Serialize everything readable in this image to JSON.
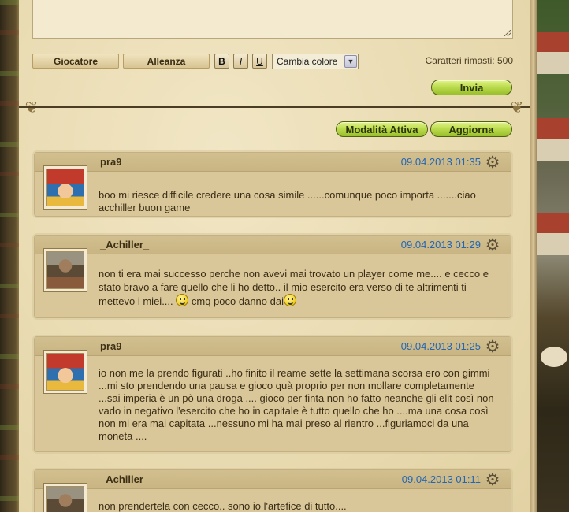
{
  "toolbar": {
    "player_label": "Giocatore",
    "alliance_label": "Alleanza",
    "bold_label": "B",
    "italic_label": "I",
    "underline_label": "U",
    "color_select_value": "Cambia colore",
    "chars_remaining": "Caratteri rimasti: 500"
  },
  "actions": {
    "send_label": "Invia",
    "active_mode_label": "Modalità Attiva",
    "refresh_label": "Aggiorna"
  },
  "posts": [
    {
      "author": "pra9",
      "date": "09.04.2013 01:35",
      "avatar": "jester",
      "text": "boo mi riesce difficile credere una cosa simile ......comunque poco importa .......ciao acchiller buon game"
    },
    {
      "author": "_Achiller_",
      "date": "09.04.2013 01:29",
      "avatar": "warrior",
      "text_part1": "non ti era mai successo perche non avevi mai trovato un player come me.... e cecco e stato bravo a fare quello che li ho detto.. il mio esercito era verso di te altrimenti ti mettevo i miei....",
      "text_part2": "cmq poco danno dai"
    },
    {
      "author": "pra9",
      "date": "09.04.2013 01:25",
      "avatar": "jester",
      "text": "io non me la prendo figurati ..ho finito il reame sette la settimana scorsa ero con gimmi ...mi sto prendendo una pausa e gioco quà proprio per non mollare completamente ...sai imperia è un pò una droga .... gioco per finta non ho fatto neanche gli elit così non vado in negativo l'esercito che ho in capitale è tutto quello che ho ....ma una cosa così non mi era mai capitata ...nessuno mi ha mai preso al rientro ...figuriamoci da una moneta ...."
    },
    {
      "author": "_Achiller_",
      "date": "09.04.2013 01:11",
      "avatar": "warrior",
      "text": "non prendertela con cecco.. sono io l'artefice di tutto...."
    }
  ],
  "icons": {
    "gear": "gear-icon",
    "smiley": "smiley-icon",
    "dropdown": "chevron-down-icon"
  },
  "colors": {
    "date": "#2466b3",
    "button_green": "#b9d94a"
  }
}
